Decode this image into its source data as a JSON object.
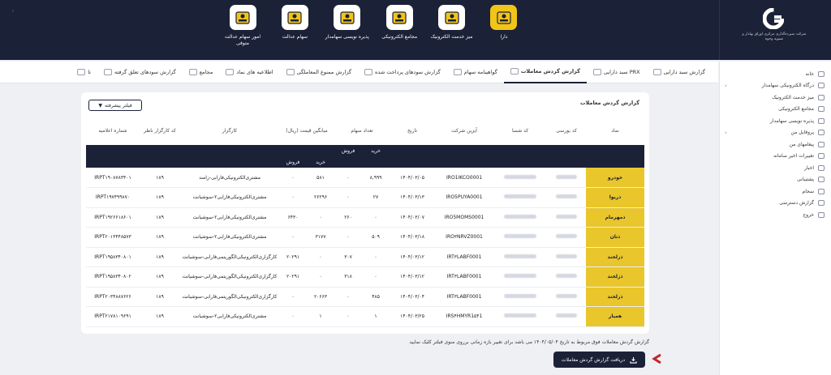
{
  "header": {
    "logo_text": "شرکت سپرده‌گذاری مرکزی اوراق بهادار و تسویه وجوه",
    "apps": [
      {
        "label": "دارا",
        "icon": "dara-icon",
        "active": true
      },
      {
        "label": "میز خدمت الکترونیک",
        "icon": "service-desk-icon",
        "active": false
      },
      {
        "label": "مجامع الکترونیکی",
        "icon": "assembly-icon",
        "active": false
      },
      {
        "label": "پذیره نویسی سهامدار",
        "icon": "subscription-icon",
        "active": false
      },
      {
        "label": "سهام عدالت",
        "icon": "justice-shares-icon",
        "active": false
      },
      {
        "label": "امور سهام عدالت متوفی",
        "icon": "deceased-shares-icon",
        "active": false
      }
    ]
  },
  "tabs": [
    {
      "label": "گزارش سبد دارایی",
      "active": false
    },
    {
      "label": "سبد دارایی PRX",
      "active": false
    },
    {
      "label": "گزارش گردش معاملات",
      "active": true
    },
    {
      "label": "گواهینامه سهام",
      "active": false
    },
    {
      "label": "گزارش سودهای پرداخت شده",
      "active": false
    },
    {
      "label": "گزارش ممنوع المعاملگی",
      "active": false
    },
    {
      "label": "اطلاعیه های نماد",
      "active": false
    },
    {
      "label": "مجامع",
      "active": false
    },
    {
      "label": "گزارش سودهای تعلق گرفته",
      "active": false
    },
    {
      "label": "تا",
      "active": false
    }
  ],
  "sidebar": {
    "items": [
      {
        "label": "خانه",
        "icon": "home-icon",
        "arrow": false
      },
      {
        "label": "درگاه الکترونیکی سهامدار",
        "icon": "portal-icon",
        "arrow": true
      },
      {
        "label": "میز خدمت الکترونیک",
        "icon": "service-desk-icon",
        "arrow": false
      },
      {
        "label": "مجامع الکترونیکی",
        "icon": "assembly-icon",
        "arrow": false
      },
      {
        "label": "پذیره نویسی سهامدار",
        "icon": "subscription-icon",
        "arrow": false
      },
      {
        "label": "پروفایل من",
        "icon": "profile-icon",
        "arrow": true
      },
      {
        "label": "پیغامهای من",
        "icon": "messages-icon",
        "arrow": false
      },
      {
        "label": "تغییرات اخیر سامانه",
        "icon": "changes-icon",
        "arrow": false
      },
      {
        "label": "اخبار",
        "icon": "news-icon",
        "arrow": false
      },
      {
        "label": "پشتیبانی",
        "icon": "support-icon",
        "arrow": false
      },
      {
        "label": "سجام",
        "icon": "sajam-icon",
        "arrow": false
      },
      {
        "label": "گزارش دسترسی",
        "icon": "access-report-icon",
        "arrow": false
      },
      {
        "label": "خروج",
        "icon": "logout-icon",
        "arrow": false
      }
    ]
  },
  "report": {
    "title": "گزارش گردش معاملات",
    "filter_label": "فیلتر پیشرفته",
    "columns": {
      "symbol": "نماد",
      "bourse_code": "کد بورسی",
      "shasa_code": "کد شسا",
      "company_isin": "آیزین شرکت",
      "date": "تاریخ",
      "share_count": "تعداد سهام",
      "avg_price": "میانگین قیمت (ریال)",
      "broker": "کارگزار",
      "supervisor_code": "کد کارگزار ناظر",
      "notice_no": "شماره اعلامیه",
      "buy": "خرید",
      "sell": "فروش"
    },
    "rows": [
      {
        "symbol": "خودرو",
        "isin": "IRO1IKCO0001",
        "date": "۱۴۰۴/۰۳/۰۵",
        "qty_buy": "۸,۹۹۹",
        "qty_sell": "۰",
        "price_buy": "۵۸۱",
        "price_sell": "۰",
        "broker": "مشتری‌الکترونیکی‌فارابی-زامند",
        "supervisor": "۱۸۹",
        "notice": "IRPT۱۹۰۸۷۸۳۴۰۱"
      },
      {
        "symbol": "ذریوا",
        "isin": "IRO5PUYA0001",
        "date": "۱۴۰۴/۰۳/۱۳",
        "qty_buy": "۲۷",
        "qty_sell": "۰",
        "price_buy": "۲۶۲۹۶",
        "price_sell": "۰",
        "broker": "مشتری‌الکترونیکی‌فارابی۲-سوشیانت",
        "supervisor": "۱۸۹",
        "notice": "IRPT۱۹۷۴۹۹۸۷۰"
      },
      {
        "symbol": "ذمهرمام",
        "isin": "IRO5MOMS0001",
        "date": "۱۴۰۴/۰۳/۰۷",
        "qty_buy": "۰",
        "qty_sell": "۲۶۰",
        "price_buy": "۰",
        "price_sell": "۶۴۳۰",
        "broker": "مشتری‌الکترونیکی‌فارابی۲-سوشیانت",
        "supervisor": "۱۸۹",
        "notice": "IRPT۱۹۲۶۶۱۸۶۰۱"
      },
      {
        "symbol": "ذتان",
        "isin": "IRO۳NRVZ0001",
        "date": "۱۴۰۴/۰۳/۱۸",
        "qty_buy": "۵۰۹",
        "qty_sell": "۰",
        "price_buy": "۳۱۷۷",
        "price_sell": "۰",
        "broker": "مشتری‌الکترونیکی‌فارابی۲-سوشیانت",
        "supervisor": "۱۸۹",
        "notice": "IRPT۲۰۱۳۴۴۸۵۷۳"
      },
      {
        "symbol": "ذزلخند",
        "isin": "IRT۳LABF0001",
        "date": "۱۴۰۴/۰۳/۱۲",
        "qty_buy": "۰",
        "qty_sell": "۳۰۷",
        "price_buy": "۰",
        "price_sell": "۲۰۲۹۱",
        "broker": "کارگزاری‌الکترونیکی‌الگوریتمی‌فارابی-سوشیانت",
        "supervisor": "۱۸۹",
        "notice": "IRPT۱۹۵۸۳۴۰۸۰۱"
      },
      {
        "symbol": "ذزلخند",
        "isin": "IRT۳LABF0001",
        "date": "۱۴۰۴/۰۳/۱۲",
        "qty_buy": "۰",
        "qty_sell": "۳۱۸",
        "price_buy": "۰",
        "price_sell": "۲۰۲۹۱",
        "broker": "کارگزاری‌الکترونیکی‌الگوریتمی‌فارابی-سوشیانت",
        "supervisor": "۱۸۹",
        "notice": "IRPT۱۹۵۸۳۴۰۸۰۲"
      },
      {
        "symbol": "ذزلخند",
        "isin": "IRT۳LABF0001",
        "date": "۱۴۰۴/۰۳/۰۴",
        "qty_buy": "۴۸۵",
        "qty_sell": "۰",
        "price_buy": "۲۰۶۶۳",
        "price_sell": "۰",
        "broker": "کارگزاری‌الکترونیکی‌الگوریتمی‌فارابی-سوشیانت",
        "supervisor": "۱۸۹",
        "notice": "IRPT۲۰۳۴۸۸۷۶۲۶"
      },
      {
        "symbol": "همیار",
        "isin": "IRS۴HMYR1۵۴1",
        "date": "۱۴۰۴/۰۳/۲۵",
        "qty_buy": "۱",
        "qty_sell": "۰",
        "price_buy": "۱",
        "price_sell": "۰",
        "broker": "مشتری‌الکترونیکی‌فارابی۲-سوشیانت",
        "supervisor": "۱۸۹",
        "notice": "IRPT۲۱۷۸۱۰۹۶۹۱"
      }
    ]
  },
  "footer": {
    "note": "گزارش گردش معاملات فوق مربوط به تاریخ ۱۴۰۴/۰۵/۰۴ می باشد برای تغییر بازه زمانی برروی منوی فیلتر کلیک نمایید",
    "download_label": "دریافت گزارش گردش معاملات"
  },
  "colors": {
    "navy": "#1b2137",
    "gold": "#e9c62b",
    "accent_red": "#c0262d"
  }
}
